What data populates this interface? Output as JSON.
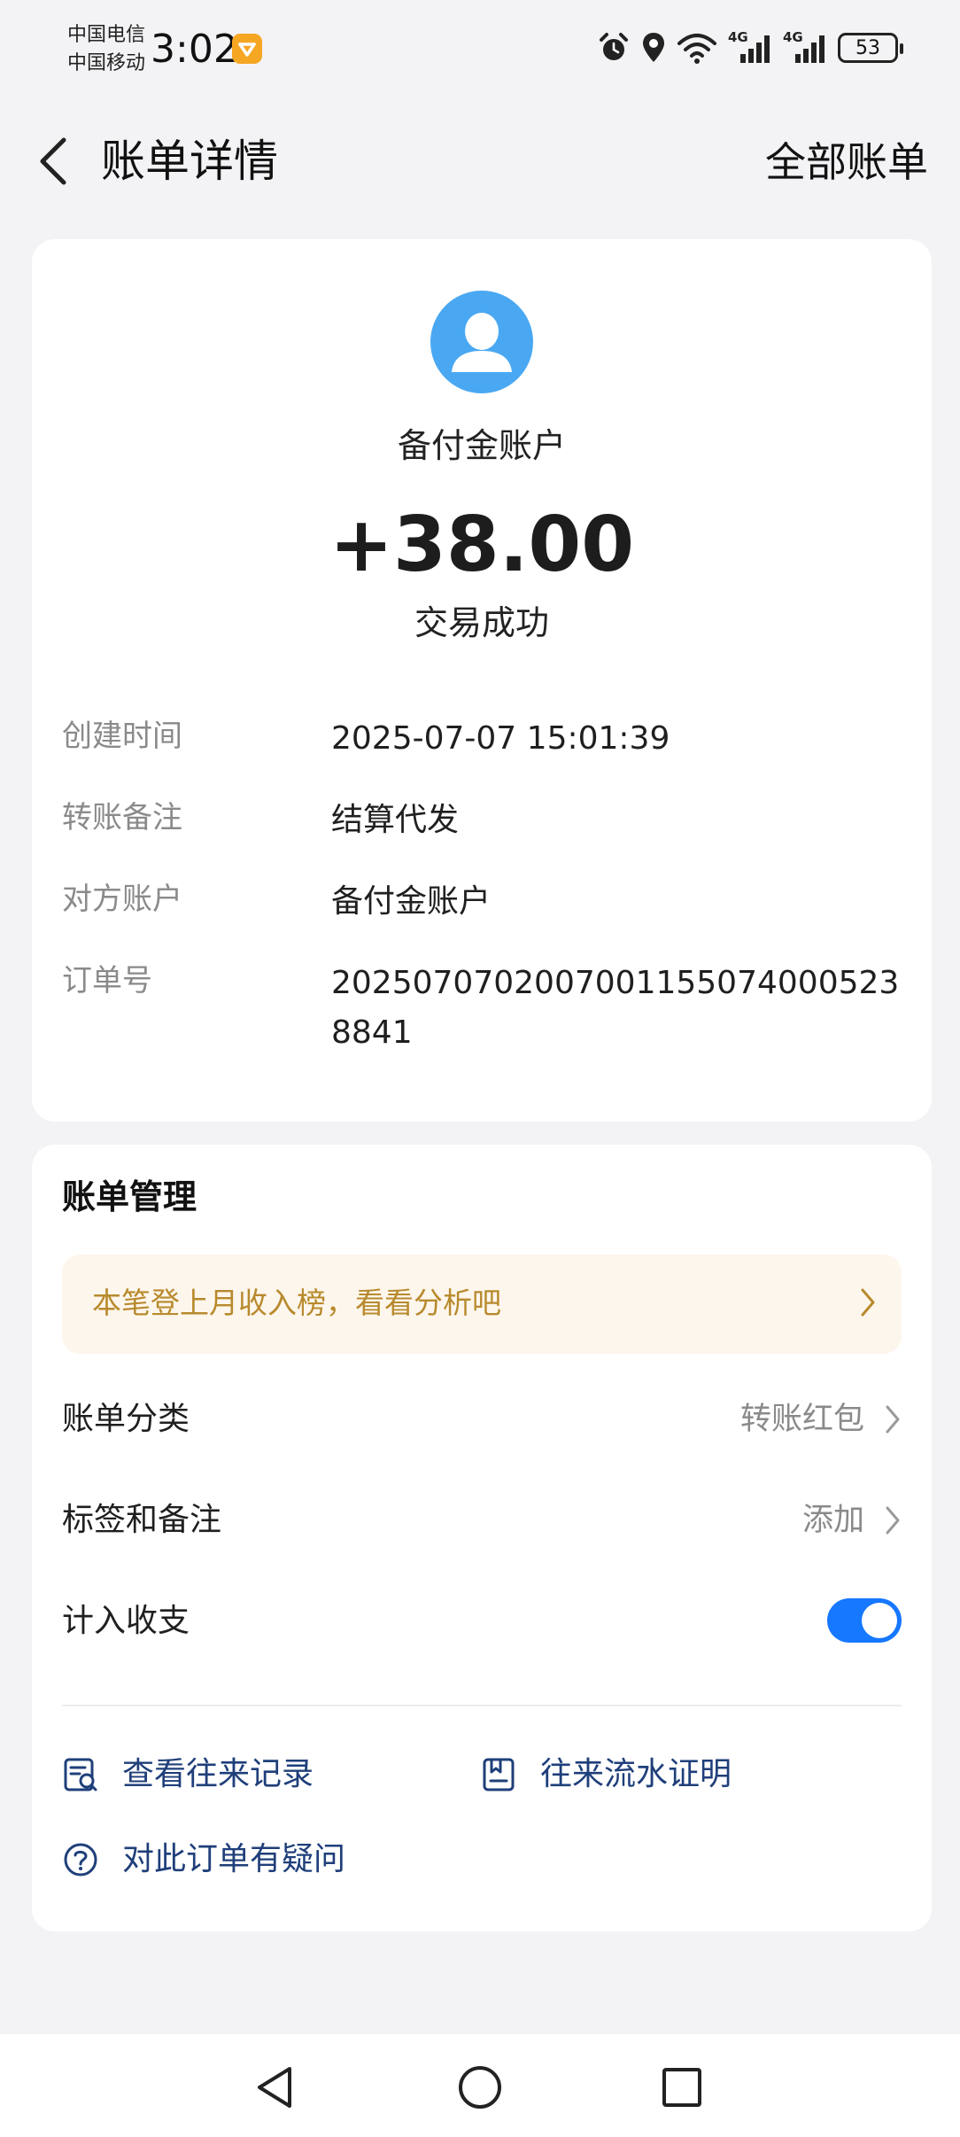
{
  "status_bar": {
    "carrier_1": "中国电信",
    "carrier_2": "中国移动",
    "time": "3:02",
    "network_1": "4G",
    "network_2": "4G",
    "battery": "53"
  },
  "header": {
    "title": "账单详情",
    "right_link": "全部账单"
  },
  "summary": {
    "payee": "备付金账户",
    "amount": "+38.00",
    "status": "交易成功",
    "details": [
      {
        "label": "创建时间",
        "value": "2025-07-07 15:01:39"
      },
      {
        "label": "转账备注",
        "value": "结算代发"
      },
      {
        "label": "对方账户",
        "value": "备付金账户"
      },
      {
        "label": "订单号",
        "value": "20250707020070011550740005238841"
      }
    ]
  },
  "manage": {
    "title": "账单管理",
    "promo": "本笔登上月收入榜，看看分析吧",
    "rows": [
      {
        "label": "账单分类",
        "value": "转账红包"
      },
      {
        "label": "标签和备注",
        "value": "添加"
      },
      {
        "label": "计入收支",
        "toggle_on": true
      }
    ],
    "actions": [
      {
        "label": "查看往来记录",
        "icon": "record-search-icon"
      },
      {
        "label": "往来流水证明",
        "icon": "document-icon"
      },
      {
        "label": "对此订单有疑问",
        "icon": "question-icon"
      }
    ]
  },
  "colors": {
    "accent": "#1677ff",
    "avatar": "#4aa8f2",
    "promo_text": "#b88a2d",
    "promo_bg": "#fdf6ec",
    "link_text": "#1f3f7a"
  }
}
